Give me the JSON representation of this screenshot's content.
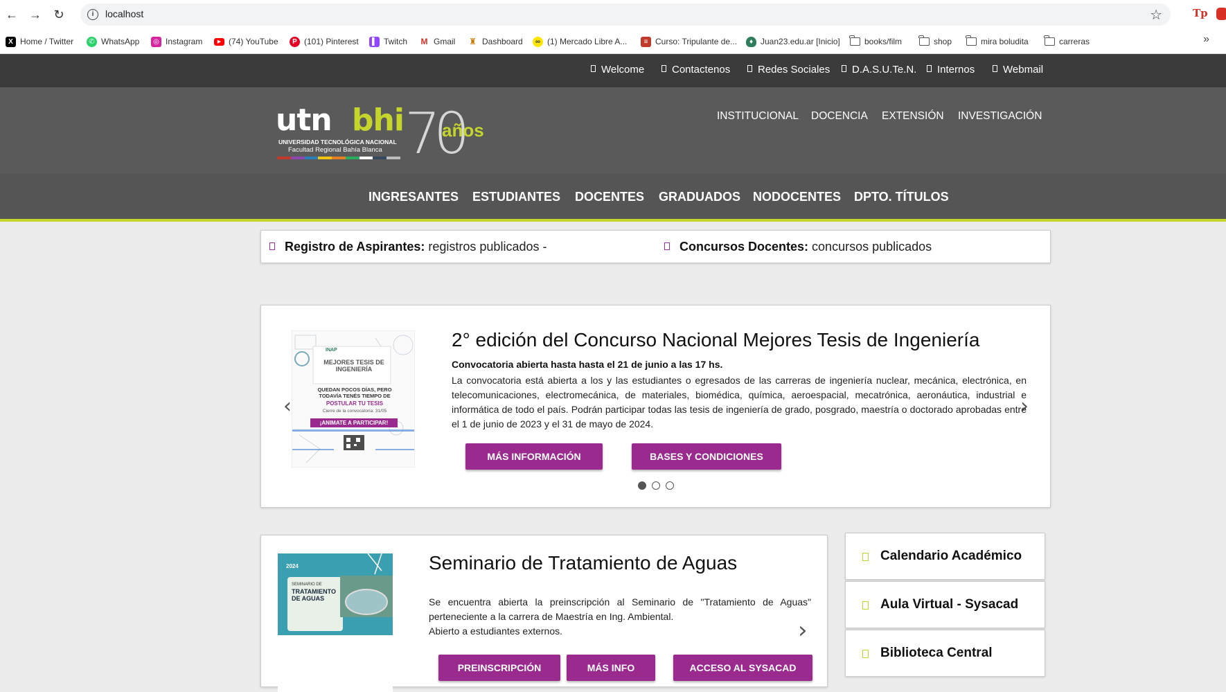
{
  "browser": {
    "url": "localhost",
    "bookmarks": [
      {
        "label": "Home / Twitter",
        "icon": "x-icon"
      },
      {
        "label": "WhatsApp",
        "icon": "whatsapp-icon"
      },
      {
        "label": "Instagram",
        "icon": "instagram-icon"
      },
      {
        "label": "(74) YouTube",
        "icon": "youtube-icon"
      },
      {
        "label": "(101) Pinterest",
        "icon": "pinterest-icon"
      },
      {
        "label": "Twitch",
        "icon": "twitch-icon"
      },
      {
        "label": "Gmail",
        "icon": "gmail-icon"
      },
      {
        "label": "Dashboard",
        "icon": "dashboard-icon"
      },
      {
        "label": "(1) Mercado Libre A...",
        "icon": "mercadolibre-icon"
      },
      {
        "label": "Curso: Tripulante de...",
        "icon": "course-icon"
      },
      {
        "label": "Juan23.edu.ar [Inicio]",
        "icon": "juan23-icon"
      },
      {
        "label": "books/film",
        "icon": "folder-icon"
      },
      {
        "label": "shop",
        "icon": "folder-icon"
      },
      {
        "label": "mira boludita",
        "icon": "folder-icon"
      },
      {
        "label": "carreras",
        "icon": "folder-icon"
      }
    ]
  },
  "topbar": {
    "links": [
      "Welcome",
      "Contactenos",
      "Redes Sociales",
      "D.A.S.U.Te.N.",
      "Internos",
      "Webmail"
    ]
  },
  "header": {
    "logo_utn": "utn",
    "logo_bhi": "bhi",
    "logo_line1": "UNIVERSIDAD TECNOLÓGICA NACIONAL",
    "logo_line2": "Facultad Regional Bahía Blanca",
    "logo_seventy": "70",
    "logo_anos": "años",
    "nav": [
      "INSTITUCIONAL",
      "DOCENCIA",
      "EXTENSIÓN",
      "INVESTIGACIÓN"
    ]
  },
  "mainnav": [
    "INGRESANTES",
    "ESTUDIANTES",
    "DOCENTES",
    "GRADUADOS",
    "NODOCENTES",
    "DPTO. TÍTULOS"
  ],
  "news_strip": [
    {
      "bold": "Registro de Aspirantes:",
      "text": " registros publicados -"
    },
    {
      "bold": "Concursos Docentes:",
      "text": " concursos publicados"
    }
  ],
  "slider": {
    "title": "2° edición del Concurso Nacional Mejores Tesis de Ingeniería",
    "subtitle": "Convocatoria abierta hasta hasta el 21 de junio a las 17 hs.",
    "body": "La convocatoria está abierta a los y las estudiantes o egresados de las carreras de ingeniería nuclear, mecánica, electrónica, en telecomunicaciones, electromecánica, de materiales, biomédica, química, aeroespacial, mecatrónica, aeronáutica, industrial e informática de todo el país. Podrán participar todas las tesis de ingeniería de grado, posgrado, maestría o doctorado aprobadas entre el 1 de junio de 2023 y el 31 de mayo de 2024.",
    "buttons": [
      "MÁS INFORMACIÓN",
      "BASES Y CONDICIONES"
    ],
    "image_text": {
      "brand": "INAP",
      "headline": "MEJORES TESIS DE INGENIERÍA",
      "line1": "QUEDAN POCOS DÍAS, PERO TODAVÍA TENÉS TIEMPO DE",
      "line2": "POSTULAR TU TESIS",
      "line3": "Cierre de la convocatoria: 31/05",
      "line4": "¡ANIMATE A PARTICIPAR!"
    },
    "dots": 3,
    "active_dot": 0
  },
  "card2": {
    "title": "Seminario de Tratamiento de Aguas",
    "body_line1": "Se encuentra abierta la preinscripción al Seminario de \"Tratamiento de Aguas\" perteneciente a la carrera de Maestría en Ing. Ambiental.",
    "body_line2": "Abierto a estudiantes externos.",
    "buttons": [
      "PREINSCRIPCIÓN",
      "MÁS INFO",
      "ACCESO AL SYSACAD"
    ],
    "image_text": {
      "year": "2024",
      "label": "SEMINARIO DE",
      "headline": "TRATAMIENTO DE AGUAS"
    }
  },
  "sidebar": [
    "Calendario Académico",
    "Aula Virtual - Sysacad",
    "Biblioteca Central"
  ],
  "colors": {
    "accent_purple": "#9b2a8f",
    "accent_green": "#c5d52c",
    "topbar": "#3b3b3b",
    "header": "#5a5a5a"
  }
}
